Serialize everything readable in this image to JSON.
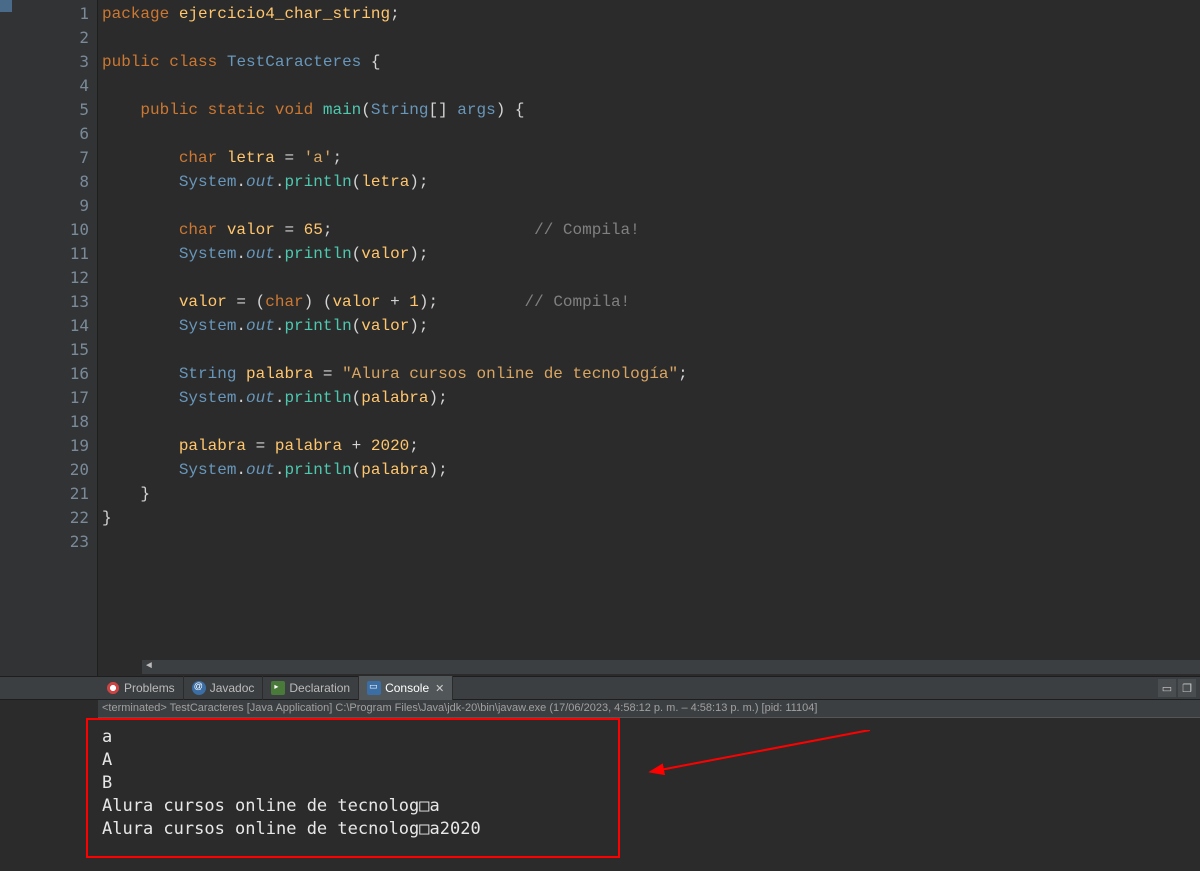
{
  "editor": {
    "lines": [
      {
        "n": "1",
        "tokens": [
          {
            "c": "kw",
            "t": "package"
          },
          {
            "c": "pun",
            "t": " "
          },
          {
            "c": "id",
            "t": "ejercicio4_char_string"
          },
          {
            "c": "pun",
            "t": ";"
          }
        ]
      },
      {
        "n": "2",
        "tokens": []
      },
      {
        "n": "3",
        "tokens": [
          {
            "c": "kw",
            "t": "public"
          },
          {
            "c": "pun",
            "t": " "
          },
          {
            "c": "kw",
            "t": "class"
          },
          {
            "c": "pun",
            "t": " "
          },
          {
            "c": "type",
            "t": "TestCaracteres"
          },
          {
            "c": "pun",
            "t": " {"
          }
        ]
      },
      {
        "n": "4",
        "tokens": []
      },
      {
        "n": "5",
        "tokens": [
          {
            "c": "pun",
            "t": "    "
          },
          {
            "c": "kw",
            "t": "public"
          },
          {
            "c": "pun",
            "t": " "
          },
          {
            "c": "kw",
            "t": "static"
          },
          {
            "c": "pun",
            "t": " "
          },
          {
            "c": "kw",
            "t": "void"
          },
          {
            "c": "pun",
            "t": " "
          },
          {
            "c": "mth",
            "t": "main"
          },
          {
            "c": "pun",
            "t": "("
          },
          {
            "c": "type",
            "t": "String"
          },
          {
            "c": "pun",
            "t": "[] "
          },
          {
            "c": "type",
            "t": "args"
          },
          {
            "c": "pun",
            "t": ") {"
          }
        ]
      },
      {
        "n": "6",
        "tokens": []
      },
      {
        "n": "7",
        "tokens": [
          {
            "c": "pun",
            "t": "        "
          },
          {
            "c": "kw",
            "t": "char"
          },
          {
            "c": "pun",
            "t": " "
          },
          {
            "c": "id",
            "t": "letra"
          },
          {
            "c": "pun",
            "t": " = "
          },
          {
            "c": "chr",
            "t": "'a'"
          },
          {
            "c": "pun",
            "t": ";"
          }
        ]
      },
      {
        "n": "8",
        "tokens": [
          {
            "c": "pun",
            "t": "        "
          },
          {
            "c": "type",
            "t": "System"
          },
          {
            "c": "pun",
            "t": "."
          },
          {
            "c": "fld",
            "t": "out"
          },
          {
            "c": "pun",
            "t": "."
          },
          {
            "c": "mth",
            "t": "println"
          },
          {
            "c": "pun",
            "t": "("
          },
          {
            "c": "id",
            "t": "letra"
          },
          {
            "c": "pun",
            "t": ");"
          }
        ]
      },
      {
        "n": "9",
        "tokens": []
      },
      {
        "n": "10",
        "tokens": [
          {
            "c": "pun",
            "t": "        "
          },
          {
            "c": "kw",
            "t": "char"
          },
          {
            "c": "pun",
            "t": " "
          },
          {
            "c": "id",
            "t": "valor"
          },
          {
            "c": "pun",
            "t": " = "
          },
          {
            "c": "num",
            "t": "65"
          },
          {
            "c": "pun",
            "t": ";                     "
          },
          {
            "c": "cmt",
            "t": "// "
          },
          {
            "c": "cmt u",
            "t": "Compila"
          },
          {
            "c": "cmt",
            "t": "!"
          }
        ]
      },
      {
        "n": "11",
        "tokens": [
          {
            "c": "pun",
            "t": "        "
          },
          {
            "c": "type",
            "t": "System"
          },
          {
            "c": "pun",
            "t": "."
          },
          {
            "c": "fld",
            "t": "out"
          },
          {
            "c": "pun",
            "t": "."
          },
          {
            "c": "mth",
            "t": "println"
          },
          {
            "c": "pun",
            "t": "("
          },
          {
            "c": "id",
            "t": "valor"
          },
          {
            "c": "pun",
            "t": ");"
          }
        ]
      },
      {
        "n": "12",
        "tokens": []
      },
      {
        "n": "13",
        "tokens": [
          {
            "c": "pun",
            "t": "        "
          },
          {
            "c": "id",
            "t": "valor"
          },
          {
            "c": "pun",
            "t": " = ("
          },
          {
            "c": "kw",
            "t": "char"
          },
          {
            "c": "pun",
            "t": ") ("
          },
          {
            "c": "id",
            "t": "valor"
          },
          {
            "c": "pun",
            "t": " + "
          },
          {
            "c": "num",
            "t": "1"
          },
          {
            "c": "pun",
            "t": ");         "
          },
          {
            "c": "cmt",
            "t": "// "
          },
          {
            "c": "cmt u",
            "t": "Compila"
          },
          {
            "c": "cmt",
            "t": "!"
          }
        ]
      },
      {
        "n": "14",
        "tokens": [
          {
            "c": "pun",
            "t": "        "
          },
          {
            "c": "type",
            "t": "System"
          },
          {
            "c": "pun",
            "t": "."
          },
          {
            "c": "fld",
            "t": "out"
          },
          {
            "c": "pun",
            "t": "."
          },
          {
            "c": "mth",
            "t": "println"
          },
          {
            "c": "pun",
            "t": "("
          },
          {
            "c": "id",
            "t": "valor"
          },
          {
            "c": "pun",
            "t": ");"
          }
        ]
      },
      {
        "n": "15",
        "tokens": []
      },
      {
        "n": "16",
        "tokens": [
          {
            "c": "pun",
            "t": "        "
          },
          {
            "c": "type",
            "t": "String"
          },
          {
            "c": "pun",
            "t": " "
          },
          {
            "c": "id",
            "t": "palabra"
          },
          {
            "c": "pun",
            "t": " = "
          },
          {
            "c": "str",
            "t": "\"Alura cursos online de tecnología\""
          },
          {
            "c": "pun",
            "t": ";"
          }
        ]
      },
      {
        "n": "17",
        "tokens": [
          {
            "c": "pun",
            "t": "        "
          },
          {
            "c": "type",
            "t": "System"
          },
          {
            "c": "pun",
            "t": "."
          },
          {
            "c": "fld",
            "t": "out"
          },
          {
            "c": "pun",
            "t": "."
          },
          {
            "c": "mth",
            "t": "println"
          },
          {
            "c": "pun",
            "t": "("
          },
          {
            "c": "id",
            "t": "palabra"
          },
          {
            "c": "pun",
            "t": ");"
          }
        ]
      },
      {
        "n": "18",
        "tokens": []
      },
      {
        "n": "19",
        "tokens": [
          {
            "c": "pun",
            "t": "        "
          },
          {
            "c": "id",
            "t": "palabra"
          },
          {
            "c": "pun",
            "t": " = "
          },
          {
            "c": "id",
            "t": "palabra"
          },
          {
            "c": "pun",
            "t": " + "
          },
          {
            "c": "num",
            "t": "2020"
          },
          {
            "c": "pun",
            "t": ";"
          }
        ]
      },
      {
        "n": "20",
        "tokens": [
          {
            "c": "pun",
            "t": "        "
          },
          {
            "c": "type",
            "t": "System"
          },
          {
            "c": "pun",
            "t": "."
          },
          {
            "c": "fld",
            "t": "out"
          },
          {
            "c": "pun",
            "t": "."
          },
          {
            "c": "mth",
            "t": "println"
          },
          {
            "c": "pun",
            "t": "("
          },
          {
            "c": "id",
            "t": "palabra"
          },
          {
            "c": "pun",
            "t": ");"
          }
        ]
      },
      {
        "n": "21",
        "tokens": [
          {
            "c": "pun",
            "t": "    }"
          }
        ]
      },
      {
        "n": "22",
        "tokens": [
          {
            "c": "pun",
            "t": "}"
          }
        ]
      },
      {
        "n": "23",
        "tokens": []
      }
    ]
  },
  "tabs": {
    "items": [
      {
        "label": "Problems",
        "icon": "ico-problem",
        "active": false
      },
      {
        "label": "Javadoc",
        "icon": "ico-javadoc",
        "active": false
      },
      {
        "label": "Declaration",
        "icon": "ico-decl",
        "active": false
      },
      {
        "label": "Console",
        "icon": "ico-console",
        "active": true,
        "closable": true
      }
    ]
  },
  "status": {
    "text": "<terminated> TestCaracteres [Java Application] C:\\Program Files\\Java\\jdk-20\\bin\\javaw.exe (17/06/2023, 4:58:12 p. m. – 4:58:13 p. m.) [pid: 11104]"
  },
  "console": {
    "lines": [
      "a",
      "A",
      "B",
      "Alura cursos online de tecnolog□a",
      "Alura cursos online de tecnolog□a2020"
    ]
  }
}
